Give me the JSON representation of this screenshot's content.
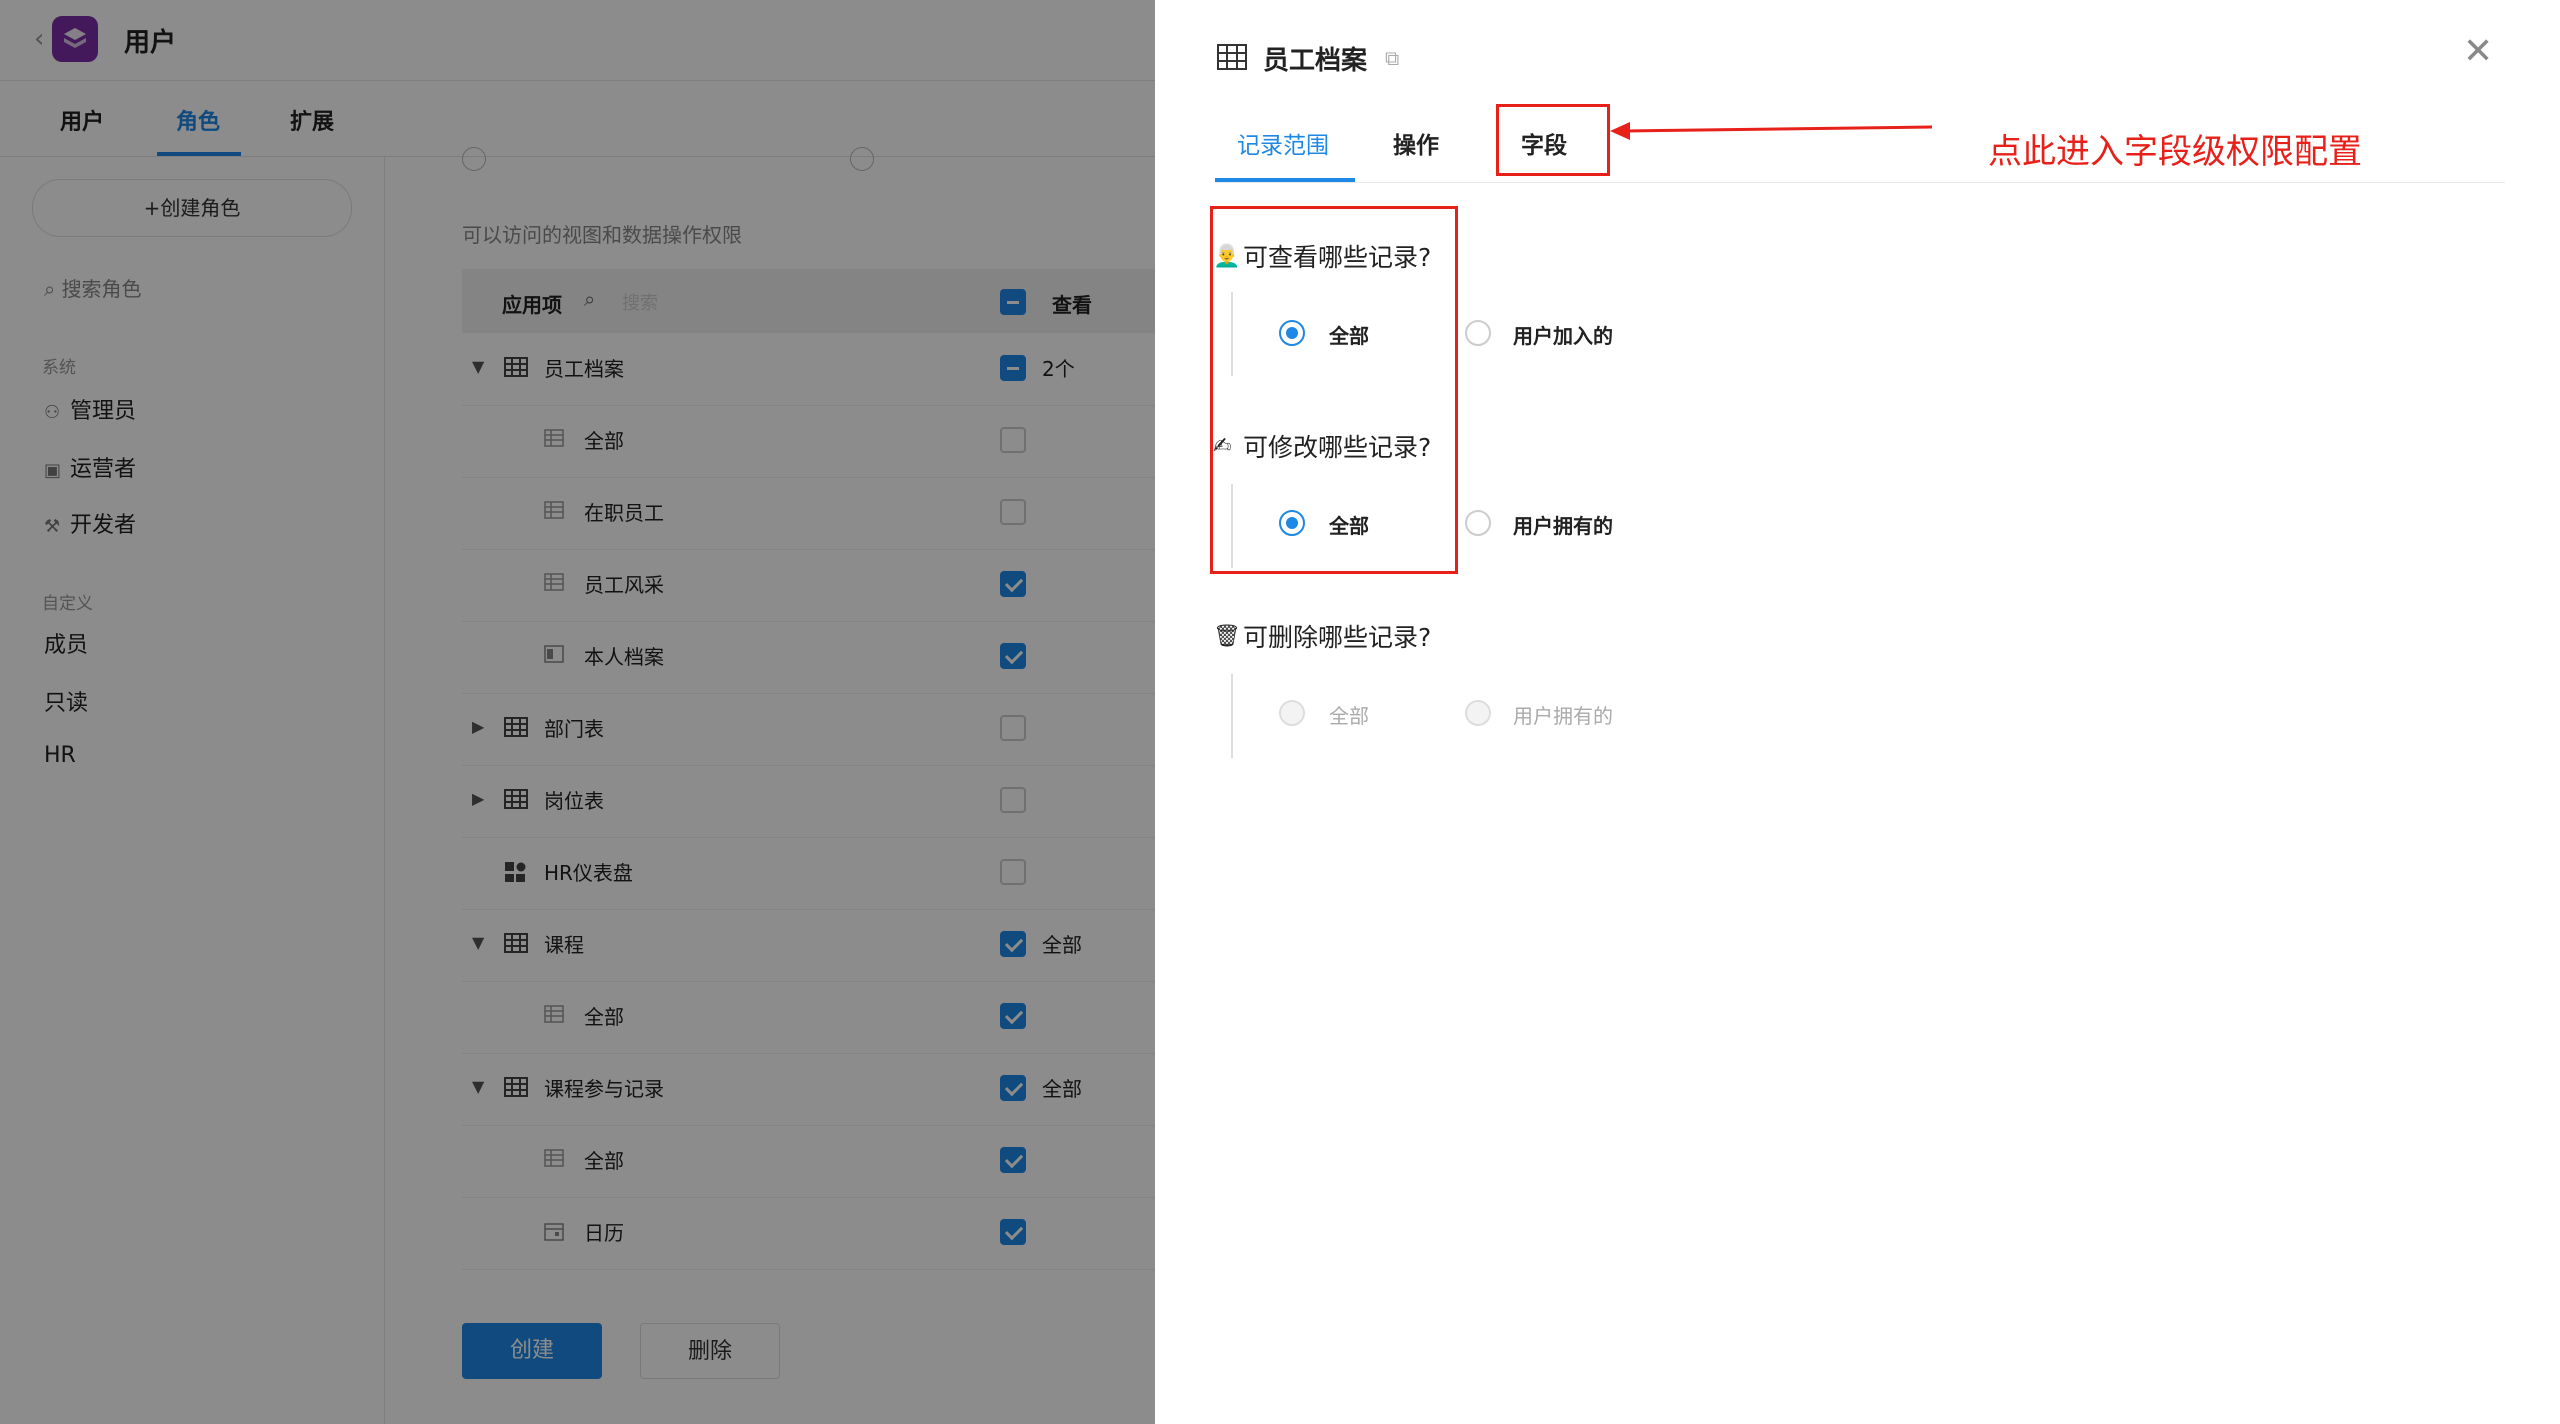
{
  "app": {
    "title": "用户",
    "tabs": [
      {
        "label": "用户"
      },
      {
        "label": "角色"
      },
      {
        "label": "扩展"
      }
    ]
  },
  "sidebar": {
    "create_role": "+创建角色",
    "search_placeholder": "搜索角色",
    "system_group": "系统",
    "system_items": [
      {
        "label": "管理员"
      },
      {
        "label": "运营者"
      },
      {
        "label": "开发者"
      }
    ],
    "custom_group": "自定义",
    "custom_items": [
      {
        "label": "成员"
      },
      {
        "label": "只读"
      },
      {
        "label": "HR"
      }
    ]
  },
  "main": {
    "hint": "可以访问的视图和数据操作权限",
    "table": {
      "col_app": "应用项",
      "search_placeholder": "搜索",
      "col_view": "查看",
      "rows": [
        {
          "label": "员工档案",
          "check": "indeterminate",
          "text": "2个"
        },
        {
          "label": "全部",
          "check": "off",
          "text": ""
        },
        {
          "label": "在职员工",
          "check": "off",
          "text": ""
        },
        {
          "label": "员工风采",
          "check": "on",
          "text": ""
        },
        {
          "label": "本人档案",
          "check": "on",
          "text": ""
        },
        {
          "label": "部门表",
          "check": "off",
          "text": ""
        },
        {
          "label": "岗位表",
          "check": "off",
          "text": ""
        },
        {
          "label": "HR仪表盘",
          "check": "off",
          "text": ""
        },
        {
          "label": "课程",
          "check": "on",
          "text": "全部"
        },
        {
          "label": "全部",
          "check": "on",
          "text": ""
        },
        {
          "label": "课程参与记录",
          "check": "on",
          "text": "全部"
        },
        {
          "label": "全部",
          "check": "on",
          "text": ""
        },
        {
          "label": "日历",
          "check": "on",
          "text": ""
        }
      ]
    },
    "btn_create": "创建",
    "btn_delete": "删除"
  },
  "drawer": {
    "title": "员工档案",
    "tabs": [
      {
        "label": "记录范围"
      },
      {
        "label": "操作"
      },
      {
        "label": "字段"
      }
    ],
    "sections": [
      {
        "emoji": "👨‍🦳",
        "title": "可查看哪些记录?",
        "options": [
          {
            "label": "全部",
            "selected": true
          },
          {
            "label": "用户加入的",
            "selected": false
          }
        ]
      },
      {
        "emoji": "✍",
        "title": "可修改哪些记录?",
        "options": [
          {
            "label": "全部",
            "selected": true
          },
          {
            "label": "用户拥有的",
            "selected": false
          }
        ]
      },
      {
        "emoji": "🗑",
        "title": "可删除哪些记录?",
        "options": [
          {
            "label": "全部",
            "selected": false
          },
          {
            "label": "用户拥有的",
            "selected": false
          }
        ]
      }
    ],
    "annotation": "点此进入字段级权限配置",
    "accent_color": "#1e88e5",
    "annotation_color": "#e8201a"
  }
}
